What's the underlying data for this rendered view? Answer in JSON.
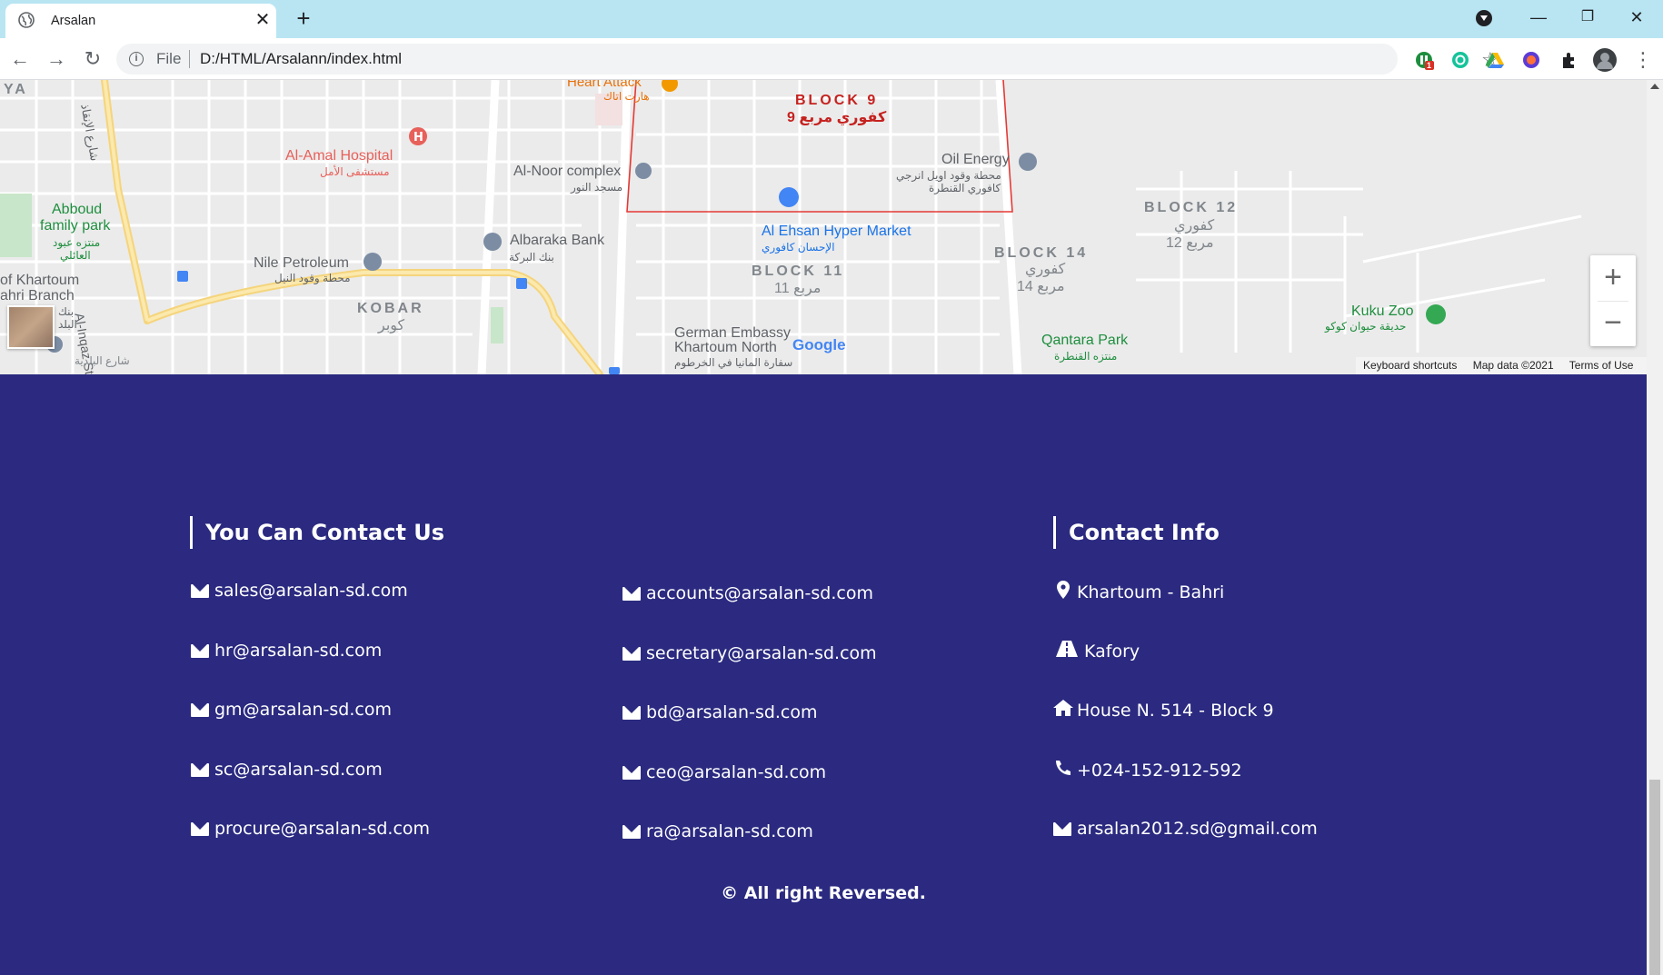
{
  "browser": {
    "tab_title": "Arsalan",
    "close_glyph": "✕",
    "new_tab_glyph": "+",
    "url_scheme": "File",
    "url": "D:/HTML/Arsalann/index.html",
    "window_controls": [
      "—",
      "❐",
      "✕"
    ],
    "extension_badge": "1"
  },
  "map": {
    "labels": {
      "block9_en": "BLOCK 9",
      "block9_ar": "كفوري مربع 9",
      "heart_attack": "Heart Attack",
      "heart_attack_ar": "هارت اتاك",
      "al_amal_hospital": "Al-Amal Hospital",
      "al_amal_hospital_ar": "مستشفى الأمل",
      "al_noor_complex": "Al-Noor complex",
      "al_noor_complex_ar": "مسجد النور",
      "oil_energy": "Oil Energy",
      "oil_energy_ar": "محطة وقود اويل انرجي",
      "oil_energy_ar2": "كافوري القنطرة",
      "block12_en": "BLOCK 12",
      "block12_ar": "كفوري",
      "block12_ar2": "12 مربع",
      "abboud_park": "Abboud",
      "abboud_park2": "family park",
      "abboud_park_ar": "منتزه عبود",
      "abboud_park_ar2": "العائلي",
      "al_ihsan_market": "Al Ehsan Hyper Market",
      "al_ihsan_market_ar": "الإحسان كافوري",
      "block14_en": "BLOCK 14",
      "block14_ar": "كفوري",
      "block14_ar2": "14 مربع",
      "albaraka_bank": "Albaraka Bank",
      "albaraka_bank_ar": "بنك البركة",
      "nile_petroleum": "Nile Petroleum",
      "nile_petroleum_ar": "محطة وقود النيل",
      "block11_en": "BLOCK 11",
      "block11_ar": "11 مربع",
      "khartoum_branch": "of Khartoum",
      "khartoum_branch2": "ahri Branch",
      "khartoum_branch_ar": "بنك",
      "khartoum_branch_ar2": "البلد",
      "kobar": "KOBAR",
      "kobar_ar": "كوبر",
      "kuku_zoo": "Kuku Zoo",
      "kuku_zoo_ar": "حديقة حيوان كوكو",
      "german_embassy": "German Embassy",
      "german_embassy2": "Khartoum North",
      "german_embassy_ar": "سفارة المانيا في الخرطوم",
      "qantara_park": "Qantara Park",
      "qantara_park_ar": "منتزه القنطرة",
      "alinqaz_st": "Al-Inqaz St",
      "alinqaz_ar": "شارع الإنقاذ",
      "baladia_ar": "شارع البلدية",
      "ya": "YA",
      "google": "Google"
    },
    "zoom_in": "+",
    "zoom_out": "−",
    "attribution": [
      "Keyboard shortcuts",
      "Map data ©2021",
      "Terms of Use"
    ]
  },
  "footer": {
    "contact_us_heading": "You Can Contact Us",
    "contact_info_heading": "Contact Info",
    "emails_col1": [
      "sales@arsalan-sd.com",
      "hr@arsalan-sd.com",
      "gm@arsalan-sd.com",
      "sc@arsalan-sd.com",
      "procure@arsalan-sd.com"
    ],
    "emails_col2": [
      "accounts@arsalan-sd.com",
      "secretary@arsalan-sd.com",
      "bd@arsalan-sd.com",
      "ceo@arsalan-sd.com",
      "ra@arsalan-sd.com"
    ],
    "info": {
      "location": "Khartoum - Bahri",
      "area": "Kafory",
      "house": "House N. 514 - Block 9",
      "phone": "+024-152-912-592",
      "email": "arsalan2012.sd@gmail.com"
    },
    "copyright": "© All right Reversed."
  },
  "colors": {
    "footer_bg": "#2b2a80",
    "tabstrip_bg": "#b9e5f3",
    "map_bg": "#ececec",
    "map_red_boundary": "#e53935"
  }
}
